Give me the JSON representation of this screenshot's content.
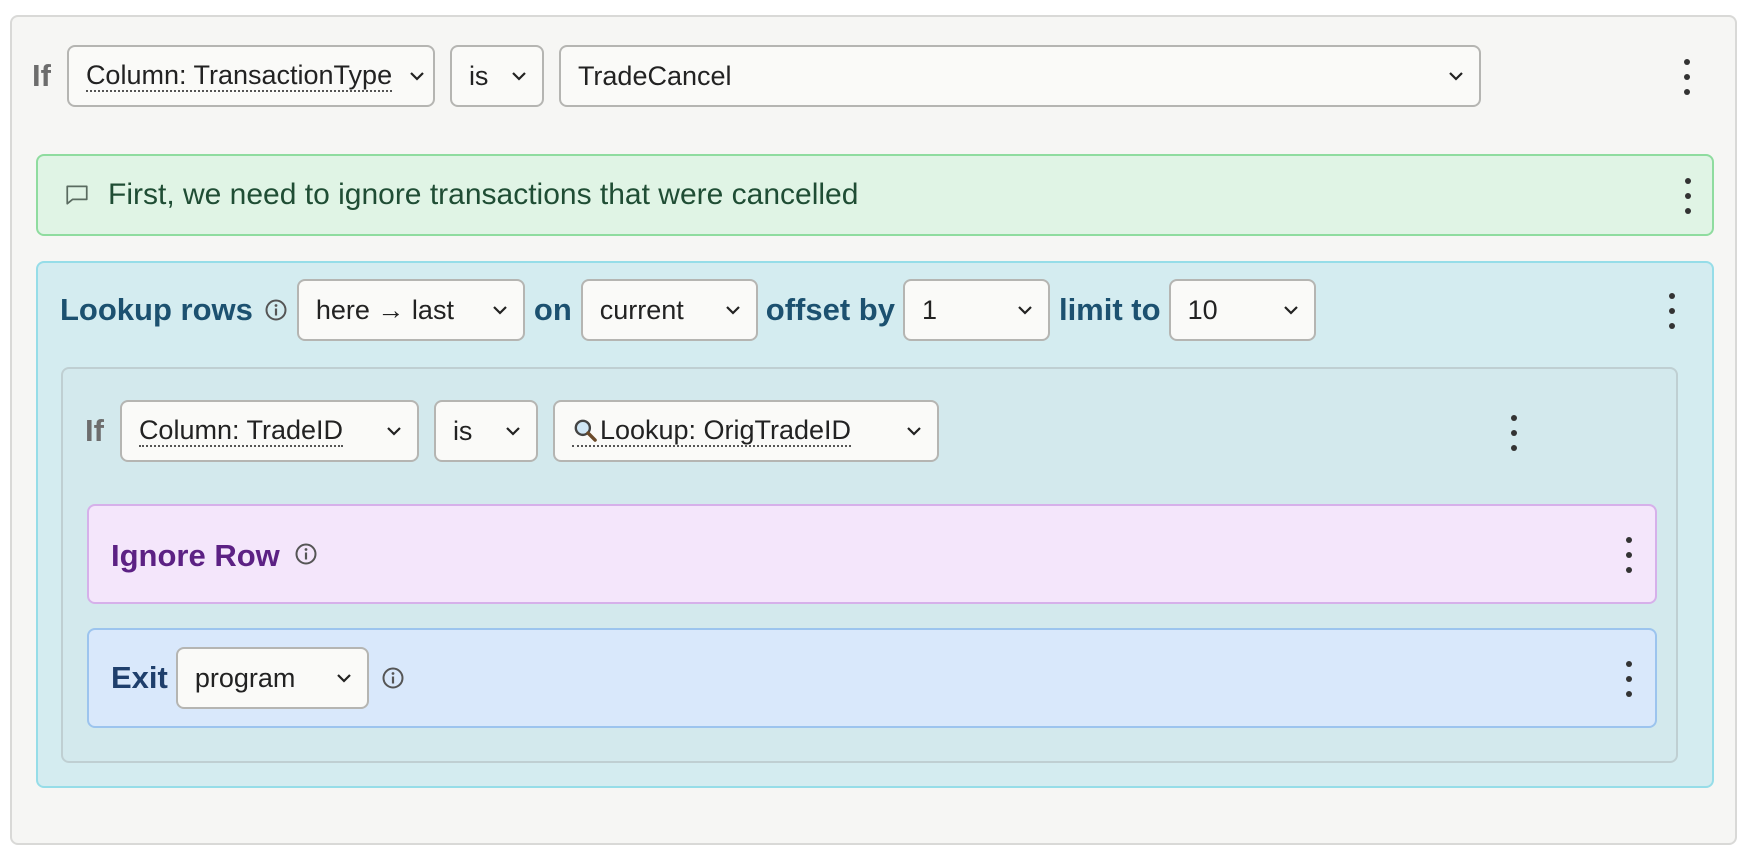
{
  "rule": {
    "if_label": "If",
    "column_select": "Column: TransactionType",
    "op_select": "is",
    "value_select": "TradeCancel"
  },
  "comment": {
    "text": "First, we need to ignore transactions that were cancelled"
  },
  "lookup": {
    "label": "Lookup rows",
    "range_select": "here → last",
    "on_label": "on",
    "on_select": "current",
    "offset_label": "offset by",
    "offset_select": "1",
    "limit_label": "limit to",
    "limit_select": "10"
  },
  "inner_rule": {
    "if_label": "If",
    "column_select": "Column: TradeID",
    "op_select": "is",
    "lookup_icon": "magnifier-icon",
    "value_select": "Lookup: OrigTradeID"
  },
  "ignore_row": {
    "label": "Ignore Row"
  },
  "exit": {
    "label": "Exit",
    "select": "program"
  },
  "colors": {
    "comment_bg": "#e0f4e5",
    "lookup_bg": "#d4ecf0",
    "ignore_bg": "#f4e6fb",
    "exit_bg": "#d9e8fb"
  }
}
